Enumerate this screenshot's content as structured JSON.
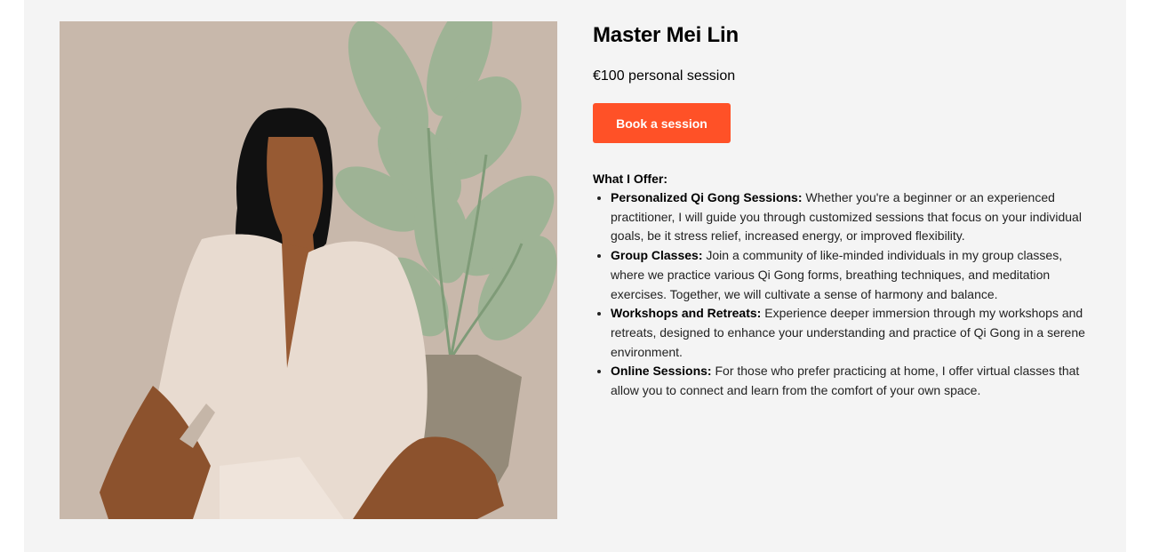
{
  "profile": {
    "name": "Master Mei Lin",
    "price": "€100 personal session",
    "book_label": "Book a session",
    "accent_color": "#ff5127"
  },
  "offer": {
    "heading": "What I Offer:",
    "items": [
      {
        "title": "Personalized Qi Gong Sessions:",
        "text": " Whether you're a beginner or an experienced practitioner, I will guide you through customized sessions that focus on your individual goals, be it stress relief, increased energy, or improved flexibility."
      },
      {
        "title": "Group Classes:",
        "text": " Join a community of like-minded individuals in my group classes, where we practice various Qi Gong forms, breathing techniques, and meditation exercises. Together, we will cultivate a sense of harmony and balance."
      },
      {
        "title": "Workshops and Retreats:",
        "text": " Experience deeper immersion through my workshops and retreats, designed to enhance your understanding and practice of Qi Gong in a serene environment."
      },
      {
        "title": "Online Sessions:",
        "text": " For those who prefer practicing at home, I offer virtual classes that allow you to connect and learn from the comfort of your own space."
      }
    ]
  }
}
